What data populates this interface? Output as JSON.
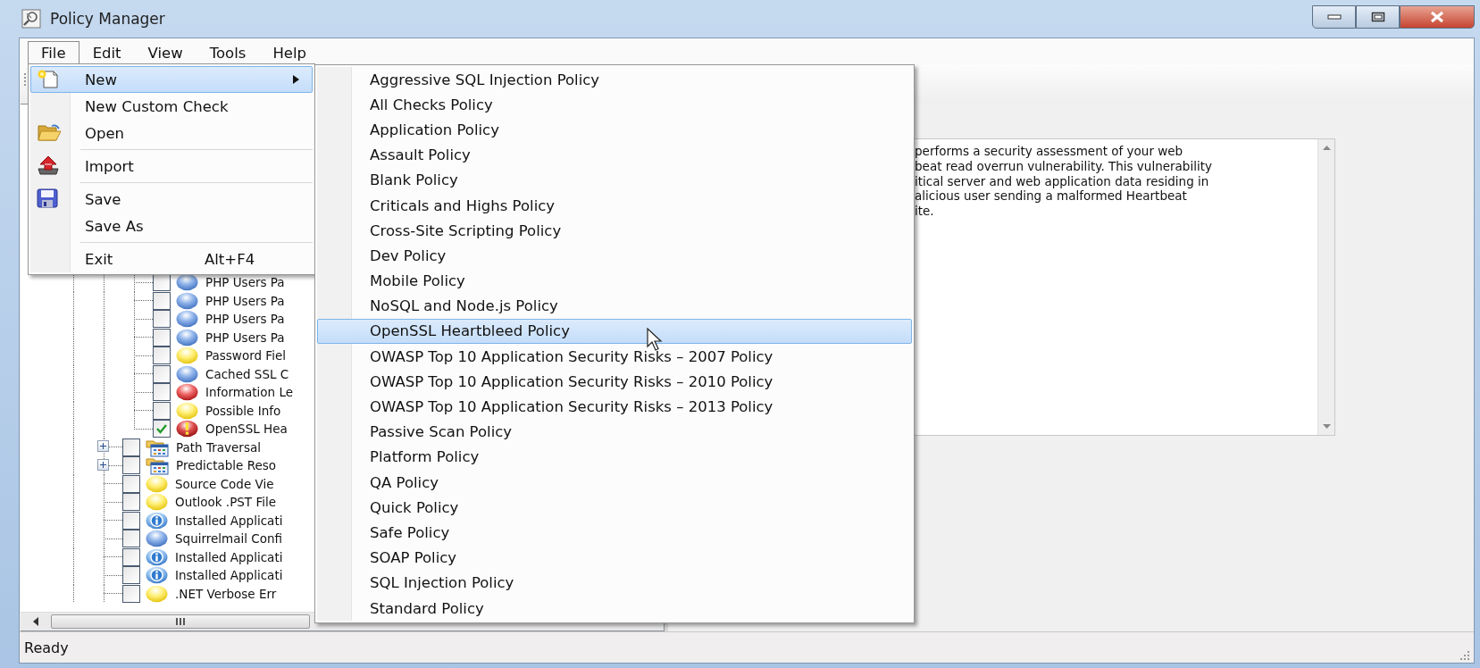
{
  "window": {
    "title": "Policy Manager"
  },
  "menu_bar": [
    {
      "label": "File",
      "selected": true
    },
    {
      "label": "Edit",
      "selected": false
    },
    {
      "label": "View",
      "selected": false
    },
    {
      "label": "Tools",
      "selected": false
    },
    {
      "label": "Help",
      "selected": false
    }
  ],
  "file_menu": [
    {
      "kind": "new",
      "label": "New",
      "submenu": true,
      "selected": true
    },
    {
      "kind": "plain",
      "label": "New Custom Check",
      "submenu": false,
      "selected": false
    },
    {
      "kind": "open",
      "label": "Open",
      "submenu": false,
      "selected": false
    },
    {
      "kind": "separator"
    },
    {
      "kind": "import",
      "label": "Import",
      "submenu": false,
      "selected": false
    },
    {
      "kind": "separator"
    },
    {
      "kind": "save",
      "label": "Save",
      "submenu": false,
      "selected": false
    },
    {
      "kind": "plain",
      "label": "Save As",
      "submenu": false,
      "selected": false
    },
    {
      "kind": "separator"
    },
    {
      "kind": "plain",
      "label": "Exit",
      "shortcut": "Alt+F4",
      "submenu": false,
      "selected": false
    }
  ],
  "new_submenu": [
    {
      "label": "Aggressive SQL Injection Policy",
      "selected": false
    },
    {
      "label": "All Checks Policy",
      "selected": false
    },
    {
      "label": "Application Policy",
      "selected": false
    },
    {
      "label": "Assault Policy",
      "selected": false
    },
    {
      "label": "Blank Policy",
      "selected": false
    },
    {
      "label": "Criticals and Highs Policy",
      "selected": false
    },
    {
      "label": "Cross-Site Scripting Policy",
      "selected": false
    },
    {
      "label": "Dev Policy",
      "selected": false
    },
    {
      "label": "Mobile Policy",
      "selected": false
    },
    {
      "label": "NoSQL and Node.js Policy",
      "selected": false
    },
    {
      "label": "OpenSSL Heartbleed Policy",
      "selected": true
    },
    {
      "label": "OWASP Top 10 Application Security Risks – 2007 Policy",
      "selected": false
    },
    {
      "label": "OWASP Top 10 Application Security Risks – 2010 Policy",
      "selected": false
    },
    {
      "label": "OWASP Top 10 Application Security Risks – 2013 Policy",
      "selected": false
    },
    {
      "label": "Passive Scan Policy",
      "selected": false
    },
    {
      "label": "Platform Policy",
      "selected": false
    },
    {
      "label": "QA Policy",
      "selected": false
    },
    {
      "label": "Quick Policy",
      "selected": false
    },
    {
      "label": "Safe Policy",
      "selected": false
    },
    {
      "label": "SOAP Policy",
      "selected": false
    },
    {
      "label": "SQL Injection Policy",
      "selected": false
    },
    {
      "label": "Standard Policy",
      "selected": false
    }
  ],
  "check_tree": [
    {
      "children": [
        {
          "kind": "low",
          "label": "PHP Users Pa",
          "checked": false
        },
        {
          "kind": "low",
          "label": "PHP Users Pa",
          "checked": false
        },
        {
          "kind": "low",
          "label": "PHP Users Pa",
          "checked": false
        },
        {
          "kind": "low",
          "label": "PHP Users Pa",
          "checked": false
        },
        {
          "kind": "medium",
          "label": "Password Fiel",
          "checked": false
        },
        {
          "kind": "low",
          "label": "Cached SSL C",
          "checked": false
        },
        {
          "kind": "high",
          "label": "Information Le",
          "checked": false
        },
        {
          "kind": "medium",
          "label": "Possible Info",
          "checked": false
        },
        {
          "kind": "critical",
          "label": "OpenSSL Hea",
          "checked": true
        }
      ]
    },
    {
      "kind": "group",
      "label": "Path Traversal",
      "checked": false,
      "expanded": false
    },
    {
      "kind": "group",
      "label": "Predictable Reso",
      "checked": false,
      "expanded": false
    },
    {
      "kind": "medium",
      "label": "Source Code Vie",
      "checked": false
    },
    {
      "kind": "medium",
      "label": "Outlook .PST File",
      "checked": false
    },
    {
      "kind": "info",
      "label": "Installed Applicati",
      "checked": false
    },
    {
      "kind": "low",
      "label": "Squirrelmail Confi",
      "checked": false
    },
    {
      "kind": "info",
      "label": "Installed Applicati",
      "checked": false
    },
    {
      "kind": "info",
      "label": "Installed Applicati",
      "checked": false
    },
    {
      "kind": "medium",
      "label": ".NET Verbose Err",
      "checked": false
    }
  ],
  "description": {
    "lines": [
      "performs a security assessment of your web",
      "beat read overrun vulnerability. This vulnerability",
      "itical server and web application data residing in",
      "alicious user sending a malformed Heartbeat",
      "ite."
    ]
  },
  "status_bar": {
    "text": "Ready"
  }
}
